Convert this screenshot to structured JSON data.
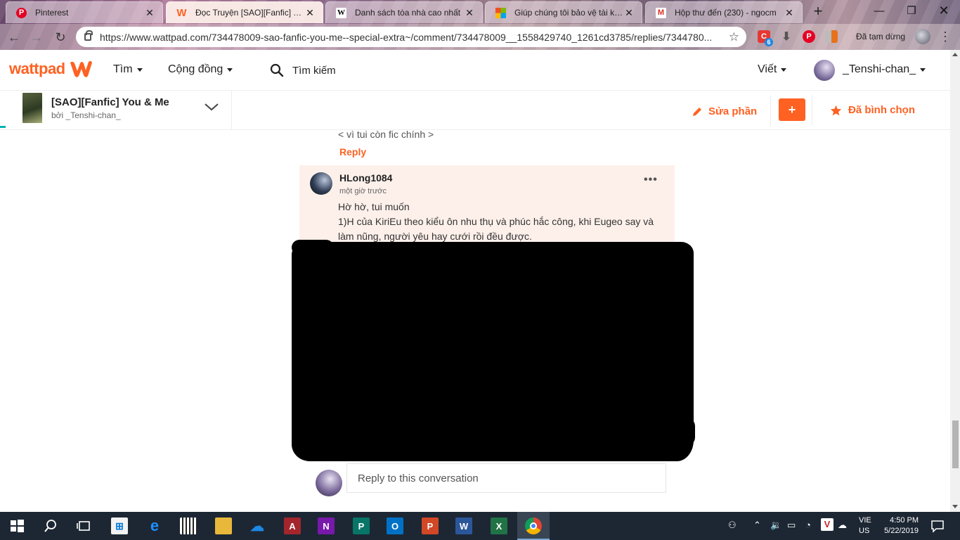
{
  "browser": {
    "tabs": [
      {
        "title": "Pinterest",
        "favicon": "pinterest-icon",
        "color": "#e60023"
      },
      {
        "title": "Đọc Truyện [SAO][Fanfic] You & Me",
        "favicon": "wattpad-icon",
        "color": "#ff6122"
      },
      {
        "title": "Danh sách tòa nhà cao nhất",
        "favicon": "wikipedia-icon",
        "color": "#ffffff"
      },
      {
        "title": "Giúp chúng tôi bảo vệ tài kho",
        "favicon": "microsoft-icon",
        "color": "#f25022"
      },
      {
        "title": "Hộp thư đến (230) - ngocm",
        "favicon": "gmail-icon",
        "color": "#d93025"
      }
    ],
    "url": "https://www.wattpad.com/734478009-sao-fanfic-you-me--special-extra~/comment/734478009__1558429740_1261cd3785/replies/7344780...",
    "paused_label": "Đã tạm dừng",
    "ext_badge": "6"
  },
  "header": {
    "logo": "wattpad",
    "nav": {
      "discover": "Tìm",
      "community": "Cộng đồng",
      "search": "Tìm kiếm",
      "write": "Viết"
    },
    "username": "_Tenshi-chan_"
  },
  "story": {
    "title": "[SAO][Fanfic] You & Me",
    "author": "bởi _Tenshi-chan_",
    "edit": "Sửa phần",
    "add": "+",
    "voted": "Đã bình chọn"
  },
  "thread": {
    "prev_text": "< vì tui còn fic chính >",
    "reply_label": "Reply",
    "comment": {
      "user": "HLong1084",
      "time": "một giờ trước",
      "more": "•••",
      "line1": "Hờ hờ, tui muốn",
      "line2": "1)H của KiriEu theo kiểu ôn nhu thụ và phúc hắc công, khi Eugeo say và làm nũng, người yêu hay cưới rồi đều được."
    },
    "reply_placeholder": "Reply to this conversation"
  },
  "taskbar": {
    "lang1": "VIE",
    "lang2": "US",
    "time": "4:50 PM",
    "date": "5/22/2019"
  },
  "colors": {
    "brand": "#ff6122",
    "card": "#fdf0ea",
    "taskbar": "#1d2734"
  }
}
